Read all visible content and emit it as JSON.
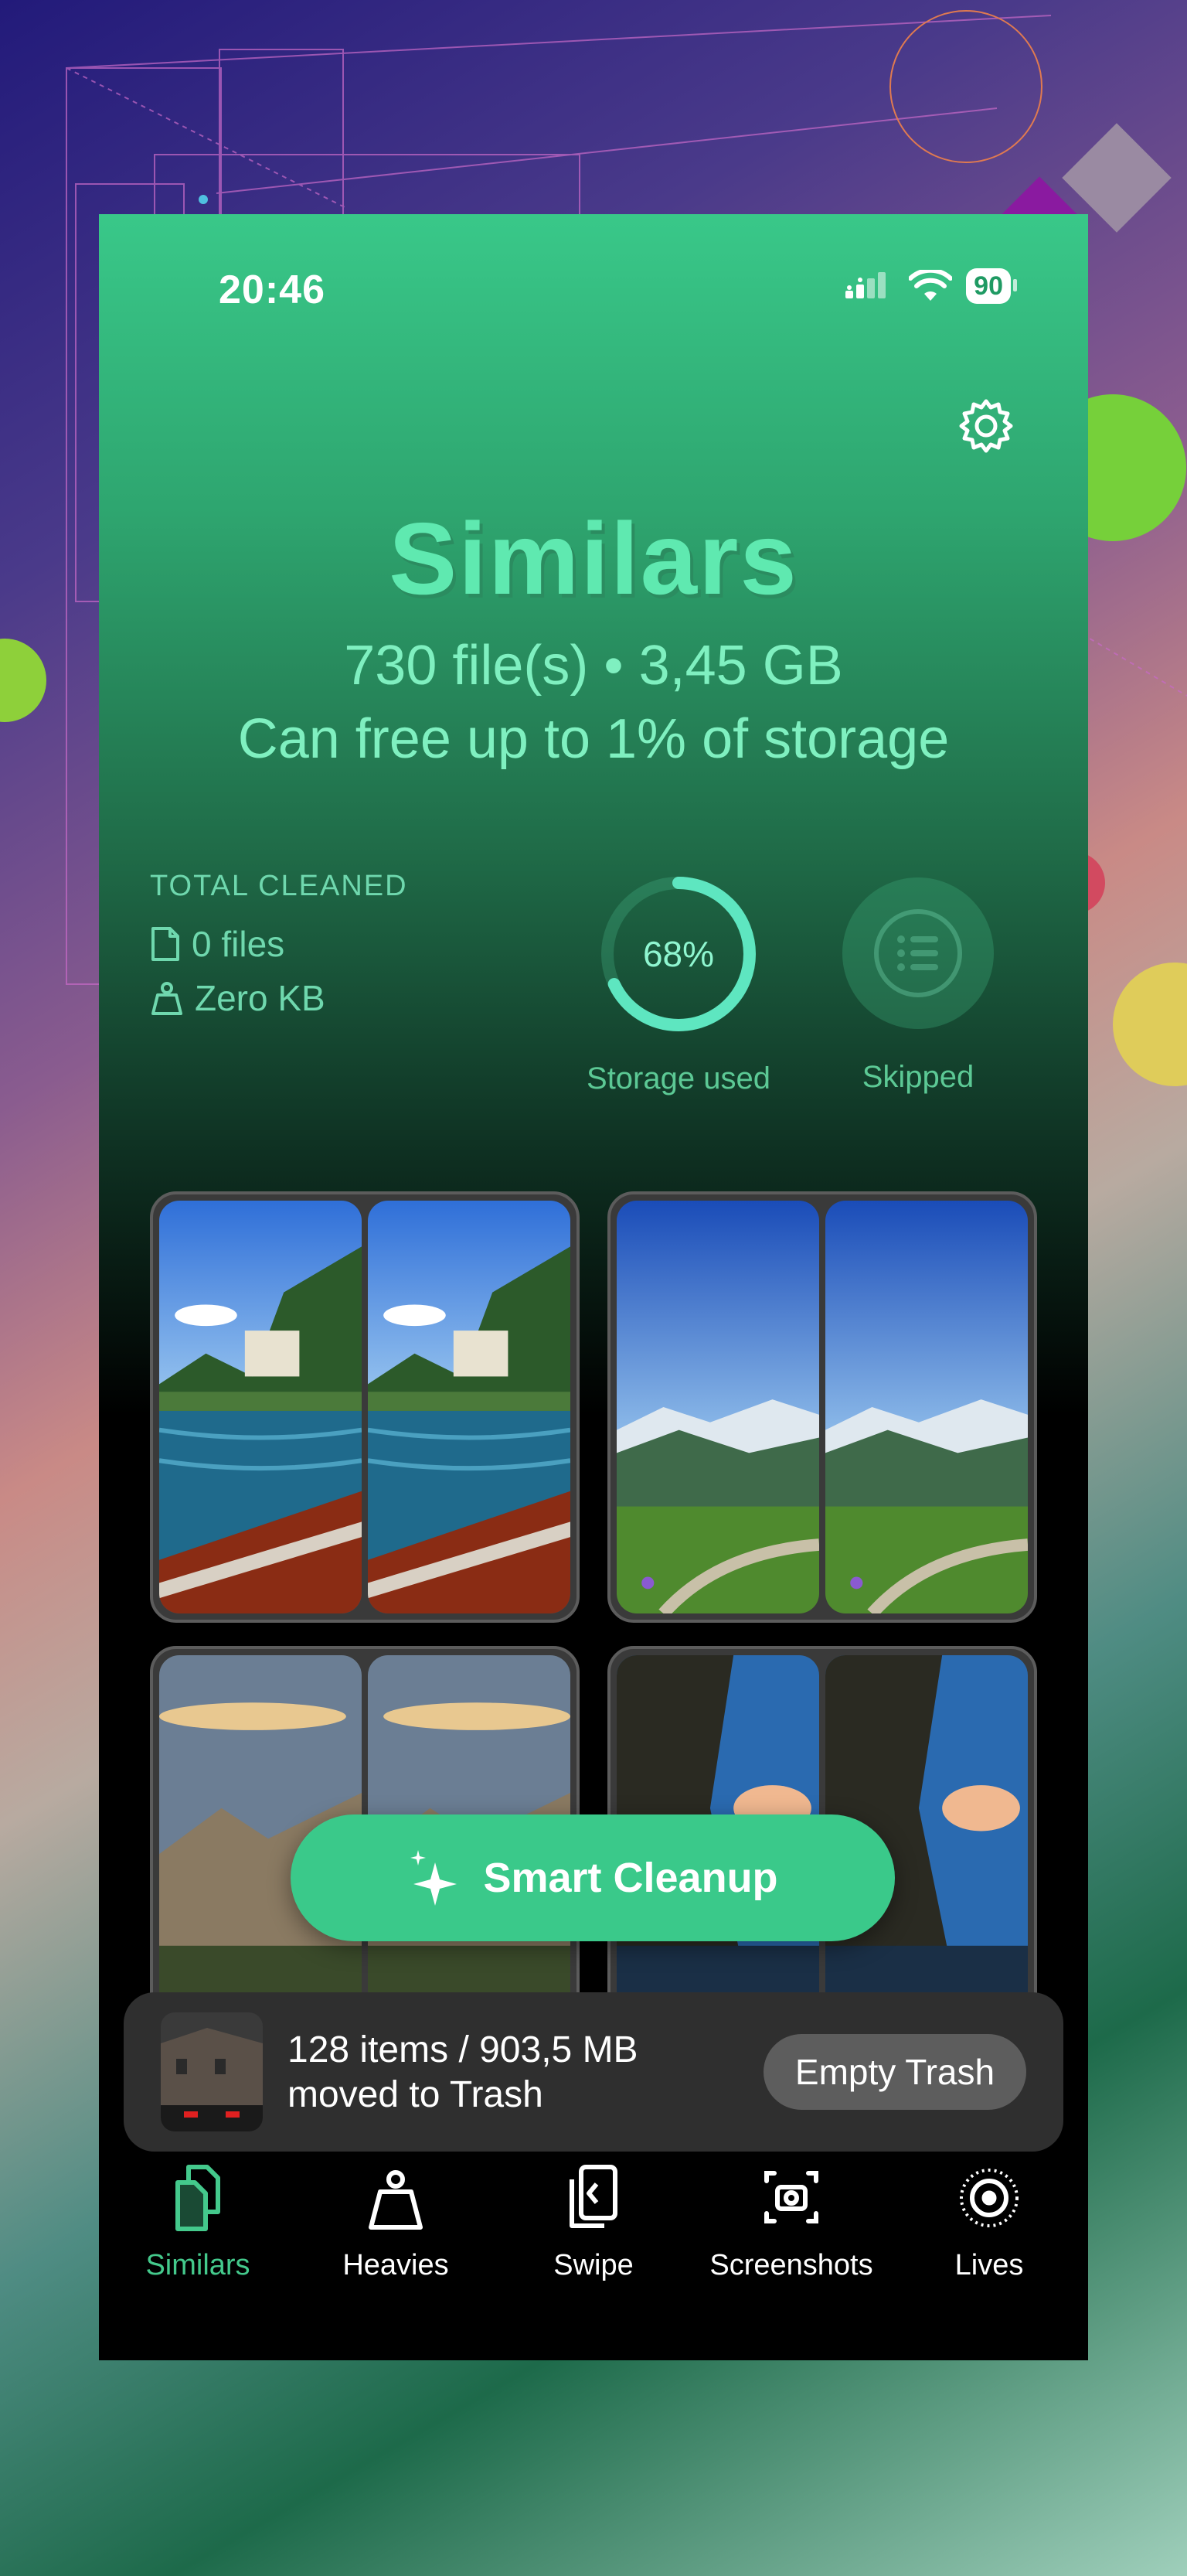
{
  "status_bar": {
    "time": "20:46",
    "battery": "90"
  },
  "header": {
    "title": "Similars",
    "summary": "730 file(s) • 3,45 GB",
    "free_up": "Can free up to 1% of storage"
  },
  "total_cleaned": {
    "label": "TOTAL CLEANED",
    "files": "0 files",
    "size": "Zero KB"
  },
  "storage": {
    "percent_text": "68%",
    "percent": 0.68,
    "label": "Storage used"
  },
  "skipped": {
    "label": "Skipped"
  },
  "smart_cleanup": {
    "label": "Smart Cleanup"
  },
  "trash": {
    "line1": "128 items / 903,5 MB",
    "line2": "moved to Trash",
    "button": "Empty Trash"
  },
  "tabs": [
    {
      "label": "Similars",
      "icon": "similars-icon",
      "active": true
    },
    {
      "label": "Heavies",
      "icon": "weight-icon",
      "active": false
    },
    {
      "label": "Swipe",
      "icon": "swipe-icon",
      "active": false
    },
    {
      "label": "Screenshots",
      "icon": "screenshot-icon",
      "active": false
    },
    {
      "label": "Lives",
      "icon": "live-photo-icon",
      "active": false
    }
  ],
  "colors": {
    "accent": "#3ac98a",
    "title": "#5fe9b0",
    "ring": "#5ee6c0"
  }
}
